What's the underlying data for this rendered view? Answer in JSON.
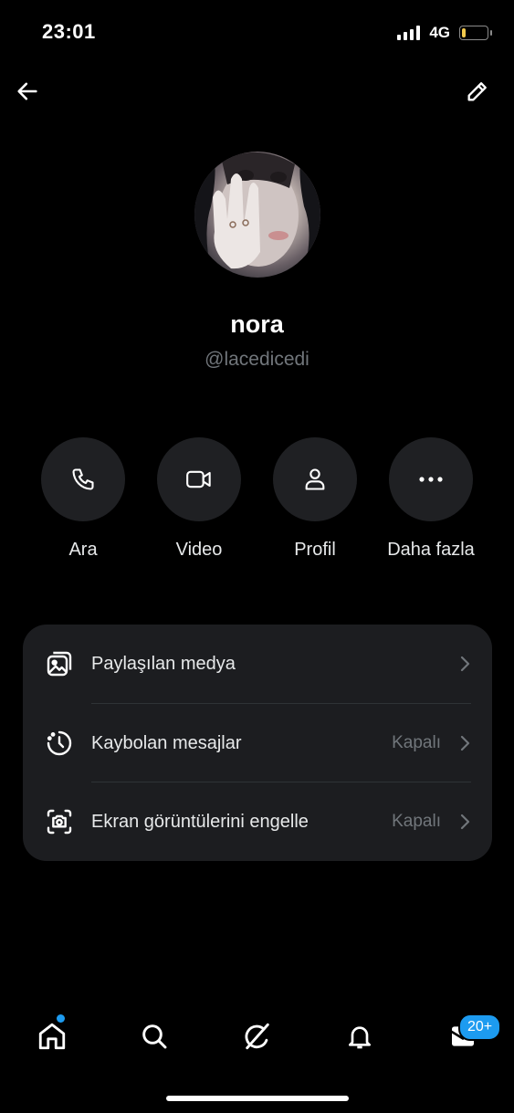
{
  "status_bar": {
    "time": "23:01",
    "network": "4G",
    "battery_level": 0.15,
    "battery_color": "#f2c94c"
  },
  "header": {
    "back_icon": "arrow-left-icon",
    "edit_icon": "pencil-icon"
  },
  "profile": {
    "display_name": "nora",
    "handle": "@lacedicedi"
  },
  "actions": [
    {
      "label": "Ara",
      "icon": "phone-icon"
    },
    {
      "label": "Video",
      "icon": "video-camera-icon"
    },
    {
      "label": "Profil",
      "icon": "person-icon"
    },
    {
      "label": "Daha fazla",
      "icon": "more-dots-icon"
    }
  ],
  "settings": [
    {
      "label": "Paylaşılan medya",
      "value": "",
      "icon": "media-gallery-icon"
    },
    {
      "label": "Kaybolan mesajlar",
      "value": "Kapalı",
      "icon": "timer-clock-icon"
    },
    {
      "label": "Ekran görüntülerini engelle",
      "value": "Kapalı",
      "icon": "screenshot-camera-icon"
    }
  ],
  "bottom_nav": {
    "tabs": [
      "home-icon",
      "search-icon",
      "grok-icon",
      "bell-icon",
      "mail-icon"
    ],
    "messages_badge": "20+",
    "accent_color": "#1d9bf0"
  }
}
